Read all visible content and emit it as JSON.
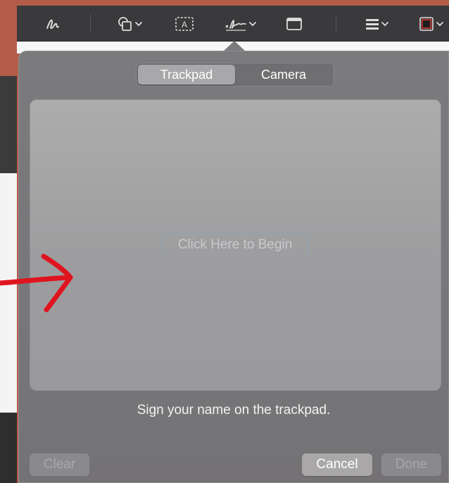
{
  "toolbar": {
    "tools": [
      {
        "name": "sketch-tool",
        "icon": "sketch-icon"
      },
      {
        "name": "shapes-tool",
        "icon": "shapes-icon"
      },
      {
        "name": "text-box-tool",
        "icon": "text-box-icon"
      },
      {
        "name": "sign-tool",
        "icon": "signature-icon"
      },
      {
        "name": "note-tool",
        "icon": "note-icon"
      },
      {
        "name": "line-style-tool",
        "icon": "line-style-icon"
      },
      {
        "name": "border-color-tool",
        "icon": "border-color-icon"
      }
    ],
    "text_box_glyph": "A"
  },
  "signature_popover": {
    "tabs": [
      {
        "label": "Trackpad",
        "selected": true
      },
      {
        "label": "Camera",
        "selected": false
      }
    ],
    "begin_label": "Click Here to Begin",
    "hint": "Sign your name on the trackpad.",
    "buttons": {
      "clear": "Clear",
      "cancel": "Cancel",
      "done": "Done"
    }
  },
  "colors": {
    "annotation": "#e0141e",
    "border_color_swatch": "#d23a30"
  }
}
